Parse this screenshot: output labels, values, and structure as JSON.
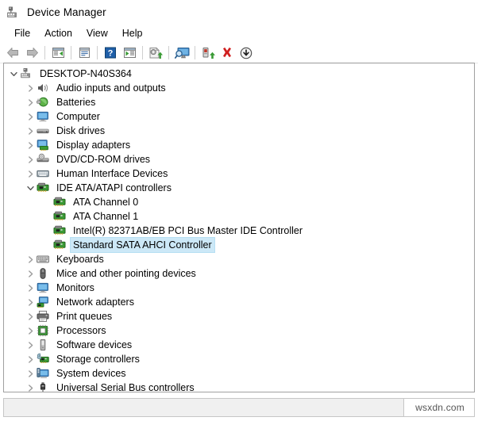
{
  "window": {
    "title": "Device Manager",
    "title_icon": "device-manager-icon"
  },
  "menubar": {
    "items": [
      {
        "label": "File",
        "name": "menu-file"
      },
      {
        "label": "Action",
        "name": "menu-action"
      },
      {
        "label": "View",
        "name": "menu-view"
      },
      {
        "label": "Help",
        "name": "menu-help"
      }
    ]
  },
  "toolbar": {
    "buttons": [
      {
        "icon": "back-arrow-icon",
        "name": "toolbar-back"
      },
      {
        "icon": "forward-arrow-icon",
        "name": "toolbar-forward"
      },
      {
        "separator": true
      },
      {
        "icon": "show-hide-console-tree-icon",
        "name": "toolbar-show-hide-console-tree"
      },
      {
        "separator": true
      },
      {
        "icon": "properties-icon",
        "name": "toolbar-properties"
      },
      {
        "separator": true
      },
      {
        "icon": "help-icon",
        "name": "toolbar-help"
      },
      {
        "icon": "show-hide-action-pane-icon",
        "name": "toolbar-show-hide-action-pane"
      },
      {
        "separator": true
      },
      {
        "icon": "update-driver-icon",
        "name": "toolbar-update-driver"
      },
      {
        "separator": true
      },
      {
        "icon": "scan-for-hardware-changes-icon",
        "name": "toolbar-scan-hardware-changes"
      },
      {
        "separator": true
      },
      {
        "icon": "enable-device-icon",
        "name": "toolbar-enable-device"
      },
      {
        "icon": "uninstall-device-icon",
        "name": "toolbar-uninstall-device"
      },
      {
        "icon": "disable-device-icon",
        "name": "toolbar-disable-device"
      }
    ]
  },
  "tree": {
    "nodes": [
      {
        "label": "DESKTOP-N40S364",
        "level": 0,
        "state": "expanded",
        "icon": "computer-root-icon",
        "selected": false
      },
      {
        "label": "Audio inputs and outputs",
        "level": 1,
        "state": "collapsed",
        "icon": "speaker-icon",
        "selected": false
      },
      {
        "label": "Batteries",
        "level": 1,
        "state": "collapsed",
        "icon": "battery-icon",
        "selected": false
      },
      {
        "label": "Computer",
        "level": 1,
        "state": "collapsed",
        "icon": "monitor-icon",
        "selected": false
      },
      {
        "label": "Disk drives",
        "level": 1,
        "state": "collapsed",
        "icon": "disk-drive-icon",
        "selected": false
      },
      {
        "label": "Display adapters",
        "level": 1,
        "state": "collapsed",
        "icon": "display-adapter-icon",
        "selected": false
      },
      {
        "label": "DVD/CD-ROM drives",
        "level": 1,
        "state": "collapsed",
        "icon": "optical-drive-icon",
        "selected": false
      },
      {
        "label": "Human Interface Devices",
        "level": 1,
        "state": "collapsed",
        "icon": "hid-icon",
        "selected": false
      },
      {
        "label": "IDE ATA/ATAPI controllers",
        "level": 1,
        "state": "expanded",
        "icon": "ide-controller-icon",
        "selected": false
      },
      {
        "label": "ATA Channel 0",
        "level": 2,
        "state": "leaf",
        "icon": "ide-controller-icon",
        "selected": false
      },
      {
        "label": "ATA Channel 1",
        "level": 2,
        "state": "leaf",
        "icon": "ide-controller-icon",
        "selected": false
      },
      {
        "label": "Intel(R) 82371AB/EB PCI Bus Master IDE Controller",
        "level": 2,
        "state": "leaf",
        "icon": "ide-controller-icon",
        "selected": false
      },
      {
        "label": "Standard SATA AHCI Controller",
        "level": 2,
        "state": "leaf",
        "icon": "ide-controller-icon",
        "selected": true
      },
      {
        "label": "Keyboards",
        "level": 1,
        "state": "collapsed",
        "icon": "keyboard-icon",
        "selected": false
      },
      {
        "label": "Mice and other pointing devices",
        "level": 1,
        "state": "collapsed",
        "icon": "mouse-icon",
        "selected": false
      },
      {
        "label": "Monitors",
        "level": 1,
        "state": "collapsed",
        "icon": "monitor-icon",
        "selected": false
      },
      {
        "label": "Network adapters",
        "level": 1,
        "state": "collapsed",
        "icon": "network-adapter-icon",
        "selected": false
      },
      {
        "label": "Print queues",
        "level": 1,
        "state": "collapsed",
        "icon": "printer-icon",
        "selected": false
      },
      {
        "label": "Processors",
        "level": 1,
        "state": "collapsed",
        "icon": "processor-icon",
        "selected": false
      },
      {
        "label": "Software devices",
        "level": 1,
        "state": "collapsed",
        "icon": "software-device-icon",
        "selected": false
      },
      {
        "label": "Storage controllers",
        "level": 1,
        "state": "collapsed",
        "icon": "storage-controller-icon",
        "selected": false
      },
      {
        "label": "System devices",
        "level": 1,
        "state": "collapsed",
        "icon": "system-device-icon",
        "selected": false
      },
      {
        "label": "Universal Serial Bus controllers",
        "level": 1,
        "state": "collapsed",
        "icon": "usb-icon",
        "selected": false
      }
    ]
  },
  "statusbar": {
    "watermark": "wsxdn.com"
  },
  "colors": {
    "selection": "#cce8f7",
    "panel_border": "#a0a0a0",
    "status_bg": "#f0f0f0",
    "arrow_gray": "#9a9a9a",
    "green": "#3a9b35",
    "blue": "#2f7fd0"
  }
}
